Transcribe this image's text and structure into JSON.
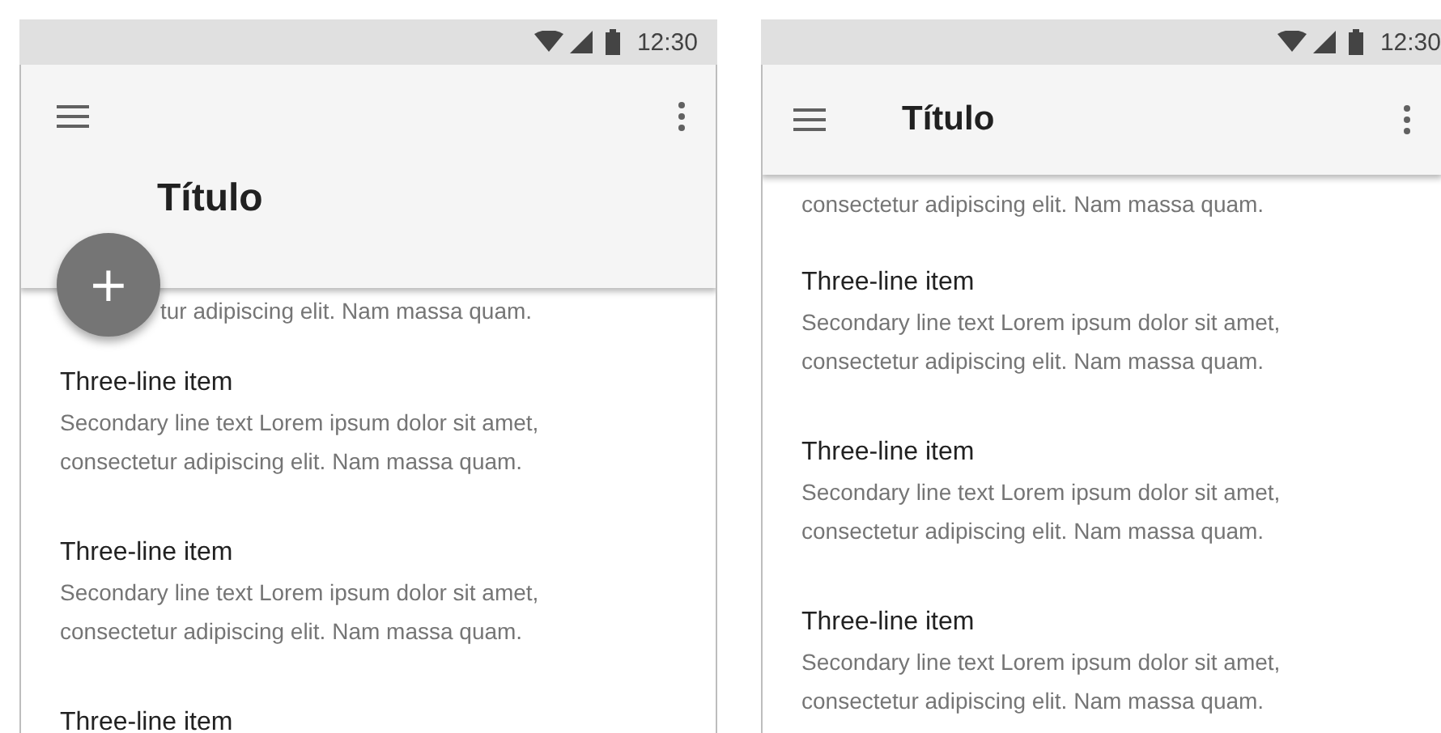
{
  "phones": [
    {
      "status_time": "12:30",
      "app_bar": {
        "kind": "extended",
        "title": "Título"
      },
      "fab": {
        "label": "+"
      },
      "top_fragment": "tur adipiscing elit. Nam massa quam.",
      "items": [
        {
          "title": "Three-line item",
          "lines": [
            "Secondary line text Lorem ipsum dolor sit amet,",
            "consectetur adipiscing elit. Nam massa quam."
          ]
        },
        {
          "title": "Three-line item",
          "lines": [
            "Secondary line text Lorem ipsum dolor sit amet,",
            "consectetur adipiscing elit. Nam massa quam."
          ]
        },
        {
          "title": "Three-line item"
        }
      ]
    },
    {
      "status_time": "12:30",
      "app_bar": {
        "kind": "regular",
        "title": "Título"
      },
      "top_fragment": "consectetur adipiscing elit. Nam massa quam.",
      "items": [
        {
          "title": "Three-line item",
          "lines": [
            "Secondary line text Lorem ipsum dolor sit amet,",
            "consectetur adipiscing elit. Nam massa quam."
          ]
        },
        {
          "title": "Three-line item",
          "lines": [
            "Secondary line text Lorem ipsum dolor sit amet,",
            "consectetur adipiscing elit. Nam massa quam."
          ]
        },
        {
          "title": "Three-line item",
          "lines": [
            "Secondary line text Lorem ipsum dolor sit amet,",
            "consectetur adipiscing elit. Nam massa quam."
          ]
        }
      ]
    }
  ]
}
